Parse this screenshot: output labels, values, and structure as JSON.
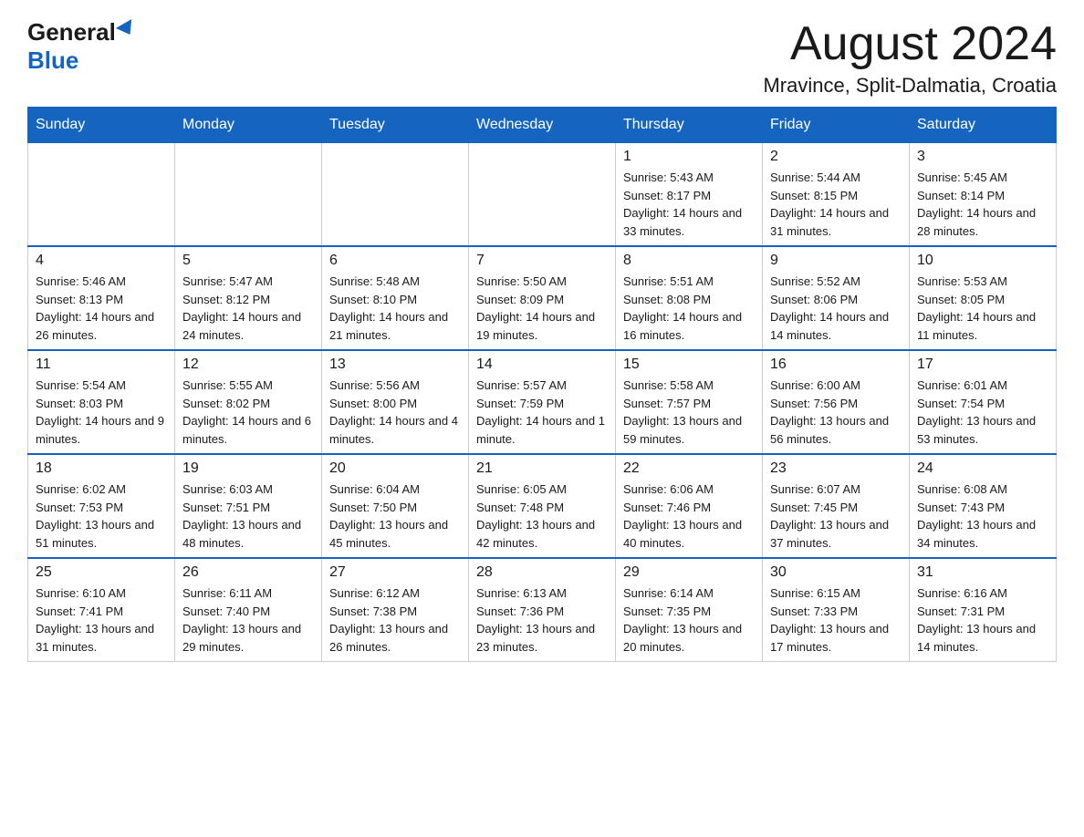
{
  "header": {
    "logo_general": "General",
    "logo_blue": "Blue",
    "month_title": "August 2024",
    "location": "Mravince, Split-Dalmatia, Croatia"
  },
  "days_of_week": [
    "Sunday",
    "Monday",
    "Tuesday",
    "Wednesday",
    "Thursday",
    "Friday",
    "Saturday"
  ],
  "weeks": [
    [
      {
        "day": "",
        "info": ""
      },
      {
        "day": "",
        "info": ""
      },
      {
        "day": "",
        "info": ""
      },
      {
        "day": "",
        "info": ""
      },
      {
        "day": "1",
        "info": "Sunrise: 5:43 AM\nSunset: 8:17 PM\nDaylight: 14 hours and 33 minutes."
      },
      {
        "day": "2",
        "info": "Sunrise: 5:44 AM\nSunset: 8:15 PM\nDaylight: 14 hours and 31 minutes."
      },
      {
        "day": "3",
        "info": "Sunrise: 5:45 AM\nSunset: 8:14 PM\nDaylight: 14 hours and 28 minutes."
      }
    ],
    [
      {
        "day": "4",
        "info": "Sunrise: 5:46 AM\nSunset: 8:13 PM\nDaylight: 14 hours and 26 minutes."
      },
      {
        "day": "5",
        "info": "Sunrise: 5:47 AM\nSunset: 8:12 PM\nDaylight: 14 hours and 24 minutes."
      },
      {
        "day": "6",
        "info": "Sunrise: 5:48 AM\nSunset: 8:10 PM\nDaylight: 14 hours and 21 minutes."
      },
      {
        "day": "7",
        "info": "Sunrise: 5:50 AM\nSunset: 8:09 PM\nDaylight: 14 hours and 19 minutes."
      },
      {
        "day": "8",
        "info": "Sunrise: 5:51 AM\nSunset: 8:08 PM\nDaylight: 14 hours and 16 minutes."
      },
      {
        "day": "9",
        "info": "Sunrise: 5:52 AM\nSunset: 8:06 PM\nDaylight: 14 hours and 14 minutes."
      },
      {
        "day": "10",
        "info": "Sunrise: 5:53 AM\nSunset: 8:05 PM\nDaylight: 14 hours and 11 minutes."
      }
    ],
    [
      {
        "day": "11",
        "info": "Sunrise: 5:54 AM\nSunset: 8:03 PM\nDaylight: 14 hours and 9 minutes."
      },
      {
        "day": "12",
        "info": "Sunrise: 5:55 AM\nSunset: 8:02 PM\nDaylight: 14 hours and 6 minutes."
      },
      {
        "day": "13",
        "info": "Sunrise: 5:56 AM\nSunset: 8:00 PM\nDaylight: 14 hours and 4 minutes."
      },
      {
        "day": "14",
        "info": "Sunrise: 5:57 AM\nSunset: 7:59 PM\nDaylight: 14 hours and 1 minute."
      },
      {
        "day": "15",
        "info": "Sunrise: 5:58 AM\nSunset: 7:57 PM\nDaylight: 13 hours and 59 minutes."
      },
      {
        "day": "16",
        "info": "Sunrise: 6:00 AM\nSunset: 7:56 PM\nDaylight: 13 hours and 56 minutes."
      },
      {
        "day": "17",
        "info": "Sunrise: 6:01 AM\nSunset: 7:54 PM\nDaylight: 13 hours and 53 minutes."
      }
    ],
    [
      {
        "day": "18",
        "info": "Sunrise: 6:02 AM\nSunset: 7:53 PM\nDaylight: 13 hours and 51 minutes."
      },
      {
        "day": "19",
        "info": "Sunrise: 6:03 AM\nSunset: 7:51 PM\nDaylight: 13 hours and 48 minutes."
      },
      {
        "day": "20",
        "info": "Sunrise: 6:04 AM\nSunset: 7:50 PM\nDaylight: 13 hours and 45 minutes."
      },
      {
        "day": "21",
        "info": "Sunrise: 6:05 AM\nSunset: 7:48 PM\nDaylight: 13 hours and 42 minutes."
      },
      {
        "day": "22",
        "info": "Sunrise: 6:06 AM\nSunset: 7:46 PM\nDaylight: 13 hours and 40 minutes."
      },
      {
        "day": "23",
        "info": "Sunrise: 6:07 AM\nSunset: 7:45 PM\nDaylight: 13 hours and 37 minutes."
      },
      {
        "day": "24",
        "info": "Sunrise: 6:08 AM\nSunset: 7:43 PM\nDaylight: 13 hours and 34 minutes."
      }
    ],
    [
      {
        "day": "25",
        "info": "Sunrise: 6:10 AM\nSunset: 7:41 PM\nDaylight: 13 hours and 31 minutes."
      },
      {
        "day": "26",
        "info": "Sunrise: 6:11 AM\nSunset: 7:40 PM\nDaylight: 13 hours and 29 minutes."
      },
      {
        "day": "27",
        "info": "Sunrise: 6:12 AM\nSunset: 7:38 PM\nDaylight: 13 hours and 26 minutes."
      },
      {
        "day": "28",
        "info": "Sunrise: 6:13 AM\nSunset: 7:36 PM\nDaylight: 13 hours and 23 minutes."
      },
      {
        "day": "29",
        "info": "Sunrise: 6:14 AM\nSunset: 7:35 PM\nDaylight: 13 hours and 20 minutes."
      },
      {
        "day": "30",
        "info": "Sunrise: 6:15 AM\nSunset: 7:33 PM\nDaylight: 13 hours and 17 minutes."
      },
      {
        "day": "31",
        "info": "Sunrise: 6:16 AM\nSunset: 7:31 PM\nDaylight: 13 hours and 14 minutes."
      }
    ]
  ]
}
